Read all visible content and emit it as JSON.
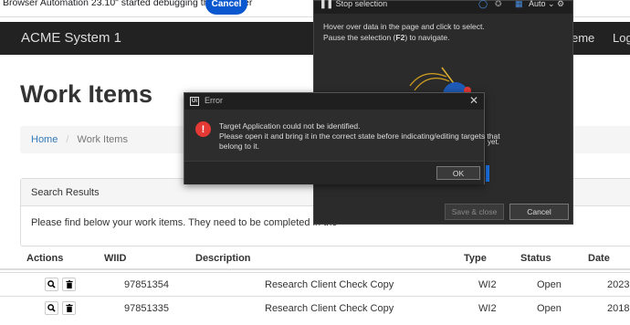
{
  "browser": {
    "debug_message": "Browser Automation 23.10\" started debugging this browser",
    "cancel_label": "Cancel"
  },
  "app": {
    "brand": "ACME System 1",
    "nav_items": [
      "eme",
      "Log"
    ]
  },
  "page": {
    "title": "Work Items",
    "breadcrumb": {
      "home": "Home",
      "separator": "/",
      "current": "Work Items"
    },
    "panel": {
      "title": "Search Results",
      "body": "Please find below your work items. They need to be completed in the"
    },
    "table": {
      "columns": [
        "Actions",
        "WIID",
        "Description",
        "Type",
        "Status",
        "Date"
      ],
      "rows": [
        {
          "wiid": "97851354",
          "description": "Research Client Check Copy",
          "type": "WI2",
          "status": "Open",
          "date": "2023"
        },
        {
          "wiid": "97851335",
          "description": "Research Client Check Copy",
          "type": "WI2",
          "status": "Open",
          "date": "2018"
        }
      ]
    }
  },
  "selection_helper": {
    "stop_label": "Stop selection",
    "mode": "Auto",
    "tip_line1": "Hover over data in the page and click to select.",
    "tip_line2_prefix": "Pause the selection (",
    "tip_key": "F2",
    "tip_line2_suffix": ") to navigate.",
    "partial_text": "yet.",
    "save_close": "Save & close",
    "cancel": "Cancel"
  },
  "error_dialog": {
    "title": "Error",
    "line1": "Target Application could not be identified.",
    "line2": "Please open it and bring it in the correct state before indicating/editing targets that",
    "line3": "belong to it.",
    "ok": "OK"
  },
  "colors": {
    "accent": "#0b57d0",
    "navbar": "#222222",
    "error": "#e53935",
    "link": "#337ab7"
  }
}
